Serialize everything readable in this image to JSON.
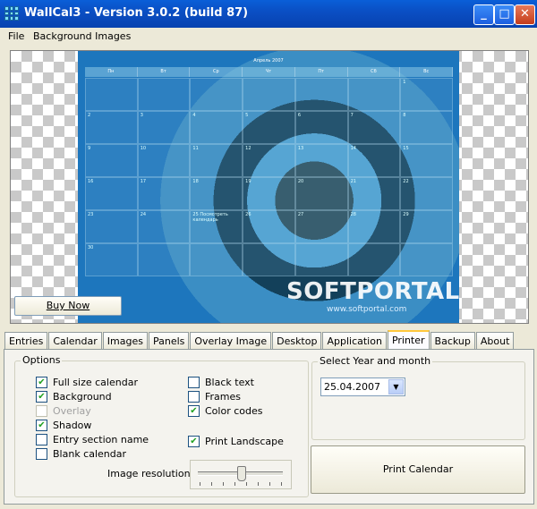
{
  "window": {
    "title": "WallCal3 - Version 3.0.2 (build 87)",
    "minimize": "_",
    "maximize": "□",
    "close": "✕"
  },
  "menu": {
    "file": "File",
    "background_images": "Background Images"
  },
  "preview": {
    "calendar_month": "Апрель 2007",
    "weekdays": [
      "Пн",
      "Вт",
      "Ср",
      "Чт",
      "Пт",
      "Сб",
      "Вс"
    ],
    "days": [
      "",
      "",
      "",
      "",
      "",
      "",
      "1",
      "2",
      "3",
      "4",
      "5",
      "6",
      "7",
      "8",
      "9",
      "10",
      "11",
      "12",
      "13",
      "14",
      "15",
      "16",
      "17",
      "18",
      "19",
      "20",
      "21",
      "22",
      "23",
      "24",
      "25 Посмотреть календарь",
      "26",
      "27",
      "28",
      "29",
      "30",
      "",
      "",
      "",
      "",
      "",
      ""
    ],
    "watermark": "SOFTPORTAL",
    "watermark_url": "www.softportal.com",
    "buy_now": "Buy Now"
  },
  "tabs": [
    "Entries",
    "Calendar",
    "Images",
    "Panels",
    "Overlay Image",
    "Desktop",
    "Application",
    "Printer",
    "Backup",
    "About"
  ],
  "active_tab": "Printer",
  "options": {
    "title": "Options",
    "full_size_calendar": {
      "label": "Full size calendar",
      "checked": true
    },
    "background": {
      "label": "Background",
      "checked": true
    },
    "overlay": {
      "label": "Overlay",
      "checked": false,
      "disabled": true
    },
    "shadow": {
      "label": "Shadow",
      "checked": true
    },
    "entry_section_name": {
      "label": "Entry section name",
      "checked": false
    },
    "blank_calendar": {
      "label": "Blank calendar",
      "checked": false
    },
    "black_text": {
      "label": "Black text",
      "checked": false
    },
    "frames": {
      "label": "Frames",
      "checked": false
    },
    "color_codes": {
      "label": "Color codes",
      "checked": true
    },
    "print_landscape": {
      "label": "Print Landscape",
      "checked": true
    },
    "image_resolution": {
      "label": "Image resolution",
      "level": 0.5
    }
  },
  "select_year": {
    "title": "Select Year and month",
    "value": "25.04.2007"
  },
  "print_button": "Print Calendar",
  "check_glyph": "✔"
}
